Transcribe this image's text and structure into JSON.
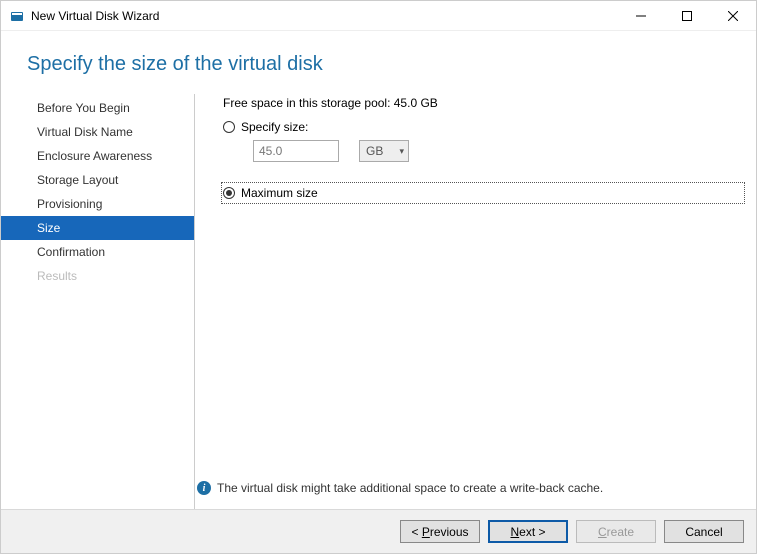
{
  "window": {
    "title": "New Virtual Disk Wizard"
  },
  "page": {
    "heading": "Specify the size of the virtual disk"
  },
  "steps": [
    {
      "label": "Before You Begin",
      "state": "normal"
    },
    {
      "label": "Virtual Disk Name",
      "state": "normal"
    },
    {
      "label": "Enclosure Awareness",
      "state": "normal"
    },
    {
      "label": "Storage Layout",
      "state": "normal"
    },
    {
      "label": "Provisioning",
      "state": "normal"
    },
    {
      "label": "Size",
      "state": "active"
    },
    {
      "label": "Confirmation",
      "state": "normal"
    },
    {
      "label": "Results",
      "state": "disabled"
    }
  ],
  "main": {
    "free_space_label": "Free space in this storage pool: 45.0 GB",
    "specify_size_label": "Specify size:",
    "size_value": "45.0",
    "size_unit": "GB",
    "maximum_size_label": "Maximum size",
    "info_text": "The virtual disk might take additional space to create a write-back cache."
  },
  "buttons": {
    "previous": "< Previous",
    "next": "Next >",
    "create": "Create",
    "cancel": "Cancel"
  }
}
